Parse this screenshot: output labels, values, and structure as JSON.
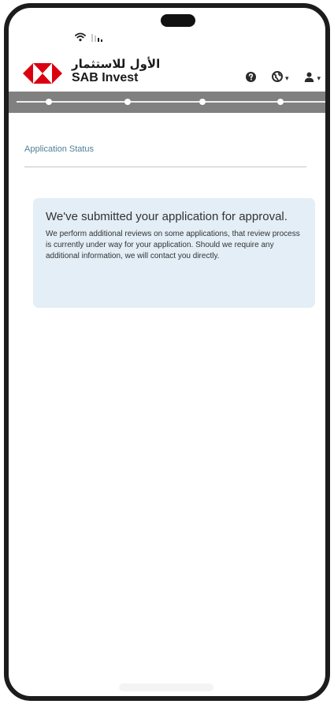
{
  "app": {
    "brand_arabic": "الأول للاستثمار",
    "brand_english": "SAB Invest",
    "brand_color": "#db0011"
  },
  "header": {
    "icons": [
      {
        "name": "help-icon"
      },
      {
        "name": "language-globe-icon",
        "dropdown": true
      },
      {
        "name": "user-icon",
        "dropdown": true
      }
    ]
  },
  "progress": {
    "steps_total": 4,
    "current_step": 4
  },
  "page": {
    "section_title": "Application Status"
  },
  "notice": {
    "heading": "We've submitted your application for approval.",
    "body": "We perform additional reviews on some applications, that review process is currently under way for your application. Should we require any additional information, we will contact you directly.",
    "background_color": "#e3eef6"
  }
}
